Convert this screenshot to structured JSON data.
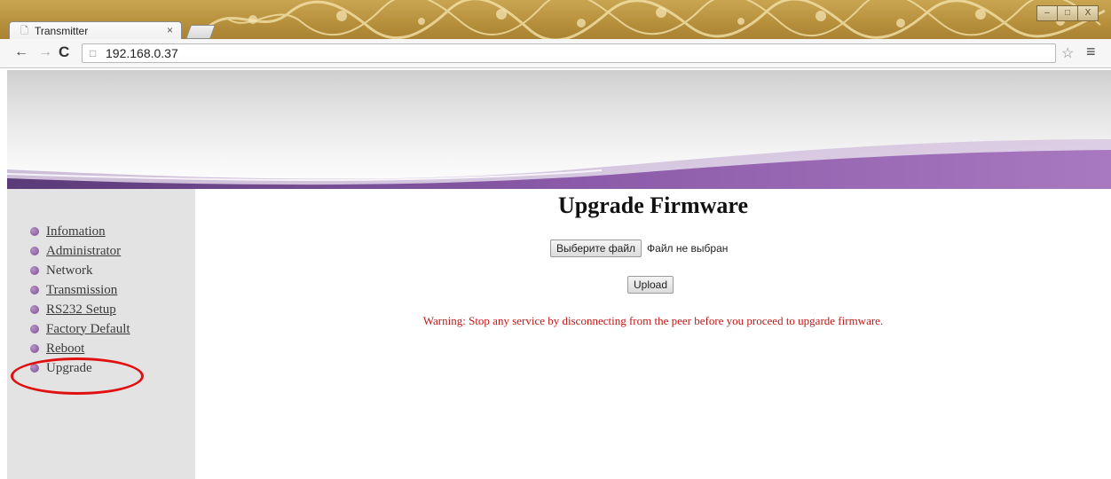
{
  "browser": {
    "tab_title": "Transmitter",
    "tab_close": "×",
    "url": "192.168.0.37",
    "window_buttons": [
      "–",
      "□",
      "X"
    ]
  },
  "sidebar": {
    "items": [
      {
        "label": "Infomation",
        "link": true
      },
      {
        "label": "Administrator",
        "link": true
      },
      {
        "label": "Network",
        "link": false
      },
      {
        "label": "Transmission",
        "link": true
      },
      {
        "label": "RS232 Setup",
        "link": true
      },
      {
        "label": "Factory Default",
        "link": true
      },
      {
        "label": "Reboot",
        "link": true
      },
      {
        "label": "Upgrade",
        "link": false
      }
    ],
    "highlighted_item": "Upgrade"
  },
  "main": {
    "title": "Upgrade Firmware",
    "choose_file_label": "Выберите файл",
    "file_status": "Файл не выбран",
    "upload_label": "Upload",
    "warning": "Warning: Stop any service by disconnecting from the peer before you proceed to upgarde firmware."
  },
  "colors": {
    "bullet": "#8a5aa3",
    "warning": "#c01818",
    "banner_wave": "#7d4a98",
    "highlight": "#e01010",
    "sidebar_bg": "#e3e3e3"
  },
  "icons": {
    "back": "arrow-left",
    "forward": "arrow-right",
    "reload": "reload",
    "page": "page",
    "star": "star",
    "menu": "hamburger"
  }
}
